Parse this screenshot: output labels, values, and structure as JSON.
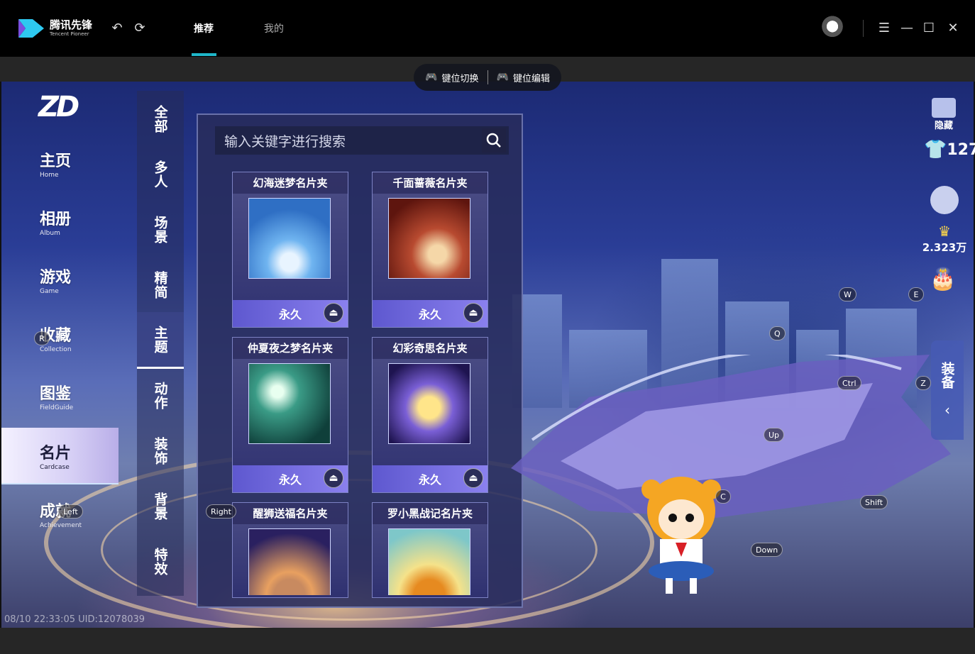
{
  "app": {
    "logo_text": "腾讯先锋",
    "logo_subtext": "Tencent Pioneer",
    "tabs": [
      {
        "label": "推荐",
        "active": true
      },
      {
        "label": "我的",
        "active": false
      }
    ]
  },
  "keymap": {
    "switch_label": "键位切换",
    "edit_label": "键位编辑"
  },
  "nav": [
    {
      "zh": "主页",
      "en": "Home"
    },
    {
      "zh": "相册",
      "en": "Album"
    },
    {
      "zh": "游戏",
      "en": "Game"
    },
    {
      "zh": "收藏",
      "en": "Collection"
    },
    {
      "zh": "图鉴",
      "en": "FieldGuide"
    },
    {
      "zh": "名片",
      "en": "Cardcase",
      "active": true
    },
    {
      "zh": "成就",
      "en": "Achievement"
    }
  ],
  "categories": [
    "全部",
    "多人",
    "场景",
    "精简",
    "主题",
    "动作",
    "装饰",
    "背景",
    "特效"
  ],
  "active_category": "主题",
  "search": {
    "placeholder": "输入关键字进行搜索"
  },
  "cards": [
    {
      "title": "幻海迷梦名片夹",
      "status": "永久",
      "theme": "#3a7fd0"
    },
    {
      "title": "千面蔷薇名片夹",
      "status": "永久",
      "theme": "#8a2a1c"
    },
    {
      "title": "仲夏夜之梦名片夹",
      "status": "永久",
      "theme": "#1f6b5c"
    },
    {
      "title": "幻彩奇思名片夹",
      "status": "永久",
      "theme": "#2a1d5a"
    },
    {
      "title": "醒狮送福名片夹",
      "status": "",
      "theme": "#3d2a52"
    },
    {
      "title": "罗小黑战记名片夹",
      "status": "",
      "theme": "#7ec7c9"
    }
  ],
  "hud": {
    "hide_label": "隐藏",
    "count": "127",
    "coins": "2.323万",
    "equip_label": "装备"
  },
  "keys": {
    "W": "W",
    "E": "E",
    "Q": "Q",
    "Ctrl": "Ctrl",
    "Z": "Z",
    "Up": "Up",
    "C": "C",
    "Shift": "Shift",
    "Down": "Down",
    "Left": "Left",
    "Right": "Right",
    "R": "R"
  },
  "status_line": "08/10 22:33:05 UID:12078039"
}
